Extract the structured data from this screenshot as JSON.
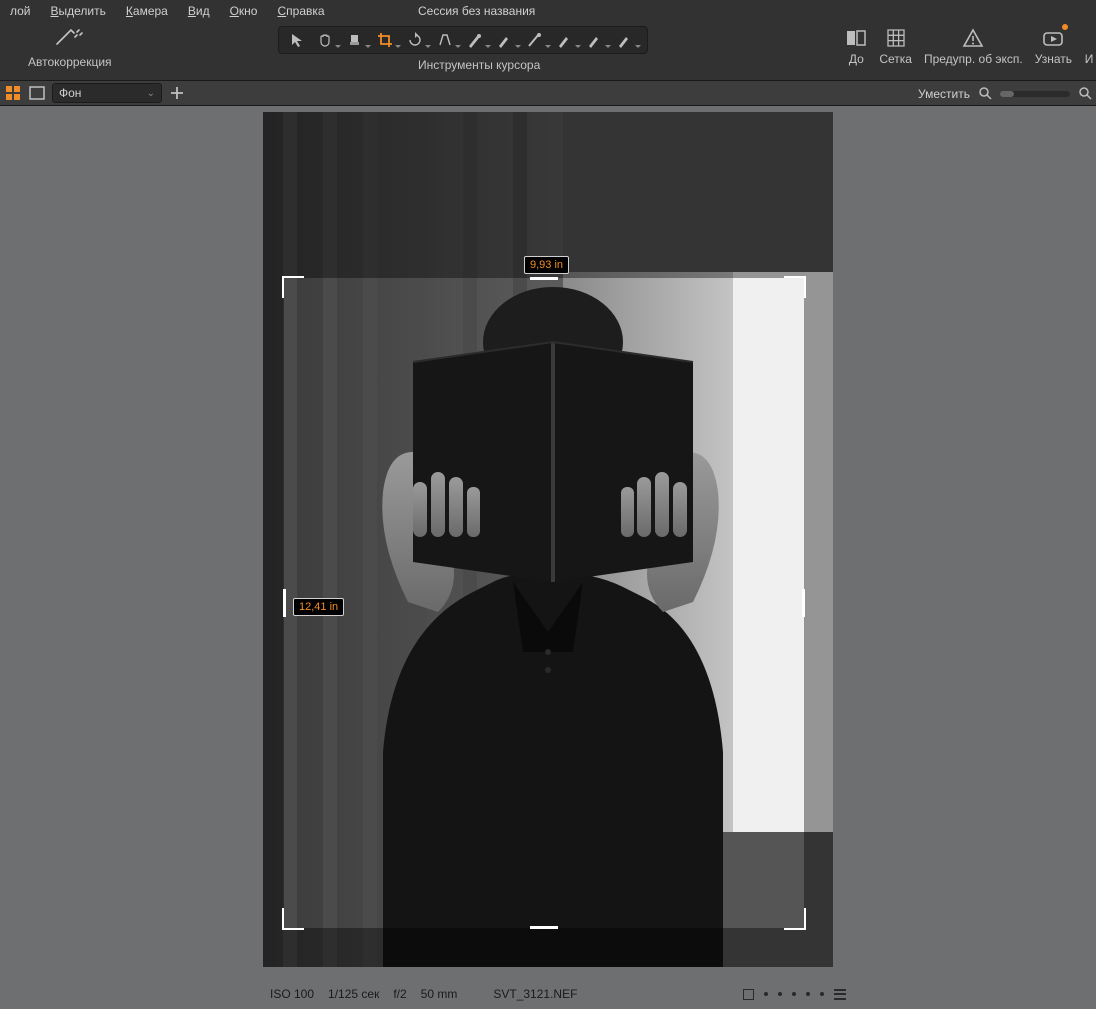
{
  "menu": {
    "items": [
      "лой",
      "Выделить",
      "Камера",
      "Вид",
      "Окно",
      "Справка"
    ],
    "underline_idx": [
      null,
      0,
      0,
      0,
      0,
      0
    ]
  },
  "session_title": "Сессия без названия",
  "toolbar": {
    "autocorrection_label": "Автокоррекция",
    "cursor_tools_label": "Инструменты курсора",
    "cursor_tools": [
      {
        "name": "pointer"
      },
      {
        "name": "hand"
      },
      {
        "name": "eyedropper-fill"
      },
      {
        "name": "crop",
        "active": true
      },
      {
        "name": "rotate"
      },
      {
        "name": "keystone"
      },
      {
        "name": "spot"
      },
      {
        "name": "brush"
      },
      {
        "name": "gradient"
      },
      {
        "name": "eraser"
      },
      {
        "name": "clone"
      },
      {
        "name": "heal"
      }
    ],
    "right": {
      "before_label": "До",
      "grid_label": "Сетка",
      "warn_label": "Предупр. об эксп.",
      "learn_label": "Узнать",
      "next_label": "И"
    }
  },
  "subbar": {
    "layer_dropdown": "Фон",
    "zoom_label": "Уместить"
  },
  "crop": {
    "width_label": "9,93 in",
    "height_label": "12,41 in"
  },
  "status": {
    "iso": "ISO 100",
    "shutter": "1/125 сек",
    "aperture": "f/2",
    "focal": "50 mm",
    "filename": "SVT_3121.NEF"
  }
}
